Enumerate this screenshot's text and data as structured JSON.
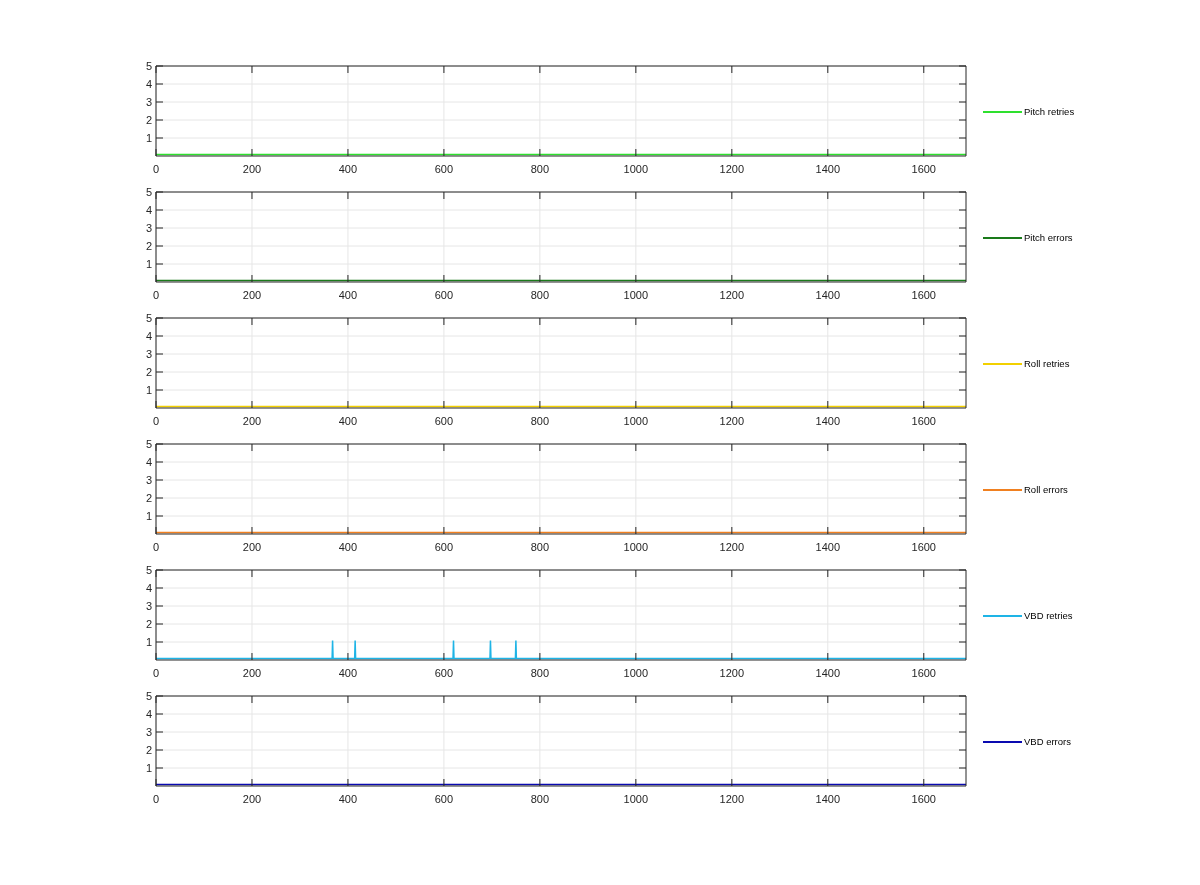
{
  "subplots": [
    {
      "chart_data": {
        "type": "line",
        "grid": true,
        "xlim": [
          0,
          1688
        ],
        "ylim": [
          0,
          5
        ],
        "xticks": [
          0,
          200,
          400,
          600,
          800,
          1000,
          1200,
          1400,
          1600
        ],
        "yticks": [
          1,
          2,
          3,
          4,
          5
        ],
        "x": [
          0,
          1688
        ],
        "series": [
          {
            "name": "Pitch retries",
            "color": "#2ee02e",
            "values": [
              0,
              0
            ]
          }
        ]
      }
    },
    {
      "chart_data": {
        "type": "line",
        "grid": true,
        "xlim": [
          0,
          1688
        ],
        "ylim": [
          0,
          5
        ],
        "xticks": [
          0,
          200,
          400,
          600,
          800,
          1000,
          1200,
          1400,
          1600
        ],
        "yticks": [
          1,
          2,
          3,
          4,
          5
        ],
        "x": [
          0,
          1688
        ],
        "series": [
          {
            "name": "Pitch errors",
            "color": "#1a7a1a",
            "values": [
              0,
              0
            ]
          }
        ]
      }
    },
    {
      "chart_data": {
        "type": "line",
        "grid": true,
        "xlim": [
          0,
          1688
        ],
        "ylim": [
          0,
          5
        ],
        "xticks": [
          0,
          200,
          400,
          600,
          800,
          1000,
          1200,
          1400,
          1600
        ],
        "yticks": [
          1,
          2,
          3,
          4,
          5
        ],
        "x": [
          0,
          1688
        ],
        "series": [
          {
            "name": "Roll retries",
            "color": "#f2d000",
            "values": [
              0,
              0
            ]
          }
        ]
      }
    },
    {
      "chart_data": {
        "type": "line",
        "grid": true,
        "xlim": [
          0,
          1688
        ],
        "ylim": [
          0,
          5
        ],
        "xticks": [
          0,
          200,
          400,
          600,
          800,
          1000,
          1200,
          1400,
          1600
        ],
        "yticks": [
          1,
          2,
          3,
          4,
          5
        ],
        "x": [
          0,
          1688
        ],
        "series": [
          {
            "name": "Roll errors",
            "color": "#f08020",
            "values": [
              0,
              0
            ]
          }
        ]
      }
    },
    {
      "chart_data": {
        "type": "line",
        "grid": true,
        "x": [
          0,
          367,
          368,
          369,
          414,
          415,
          416,
          619,
          620,
          621,
          696,
          697,
          698,
          749,
          750,
          751,
          1688
        ],
        "xlim": [
          0,
          1688
        ],
        "ylim": [
          0,
          5
        ],
        "xticks": [
          0,
          200,
          400,
          600,
          800,
          1000,
          1200,
          1400,
          1600
        ],
        "yticks": [
          1,
          2,
          3,
          4,
          5
        ],
        "series": [
          {
            "name": "VBD retries",
            "color": "#1eb4e6",
            "values": [
              0,
              0,
              1,
              0,
              0,
              1,
              0,
              0,
              1,
              0,
              0,
              1,
              0,
              0,
              1,
              0,
              0
            ]
          }
        ]
      }
    },
    {
      "chart_data": {
        "type": "line",
        "grid": true,
        "xlim": [
          0,
          1688
        ],
        "ylim": [
          0,
          5
        ],
        "xticks": [
          0,
          200,
          400,
          600,
          800,
          1000,
          1200,
          1400,
          1600
        ],
        "yticks": [
          1,
          2,
          3,
          4,
          5
        ],
        "x": [
          0,
          1688
        ],
        "series": [
          {
            "name": "VBD errors",
            "color": "#0a0ab0",
            "values": [
              0,
              0
            ]
          }
        ]
      }
    }
  ]
}
